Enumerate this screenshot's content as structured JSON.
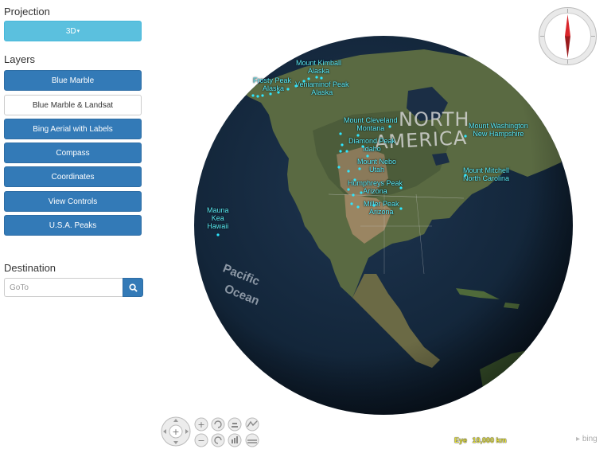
{
  "sidebar": {
    "projection_title": "Projection",
    "projection_button": "3D",
    "layers_title": "Layers",
    "layers": [
      {
        "label": "Blue Marble",
        "active": true
      },
      {
        "label": "Blue Marble & Landsat",
        "active": false
      },
      {
        "label": "Bing Aerial with Labels",
        "active": true
      },
      {
        "label": "Compass",
        "active": true
      },
      {
        "label": "Coordinates",
        "active": true
      },
      {
        "label": "View Controls",
        "active": true
      },
      {
        "label": "U.S.A. Peaks",
        "active": true
      }
    ],
    "destination_title": "Destination",
    "goto_placeholder": "GoTo"
  },
  "map": {
    "continent_label_1": "NORTH",
    "continent_label_2": "AMERICA",
    "ocean_label_1": "Pacific",
    "ocean_label_2": "Ocean",
    "peaks": [
      {
        "id": "frosty",
        "lines": [
          "Frosty Peak",
          "Alaska"
        ]
      },
      {
        "id": "kimball",
        "lines": [
          "Mount Kimball",
          "Alaska"
        ]
      },
      {
        "id": "veniaminof",
        "lines": [
          "Veniaminof Peak",
          "Alaska"
        ]
      },
      {
        "id": "cleveland",
        "lines": [
          "Mount Cleveland",
          "Montana"
        ]
      },
      {
        "id": "diamond",
        "lines": [
          "Diamond Peak",
          "Idaho"
        ]
      },
      {
        "id": "nebo",
        "lines": [
          "Mount Nebo",
          "Utah"
        ]
      },
      {
        "id": "humphreys",
        "lines": [
          "Humphreys Peak",
          "Arizona"
        ]
      },
      {
        "id": "miller",
        "lines": [
          "Miller Peak",
          "Arizona"
        ]
      },
      {
        "id": "mauna",
        "lines": [
          "Mauna",
          "Kea",
          "Hawaii"
        ]
      },
      {
        "id": "washington",
        "lines": [
          "Mount Washington",
          "New Hampshire"
        ]
      },
      {
        "id": "mitchell",
        "lines": [
          "Mount Mitchell",
          "North Carolina"
        ]
      }
    ]
  },
  "status": {
    "eye_label": "Eye",
    "eye_value": "10,000 km",
    "attribution": "bing"
  }
}
